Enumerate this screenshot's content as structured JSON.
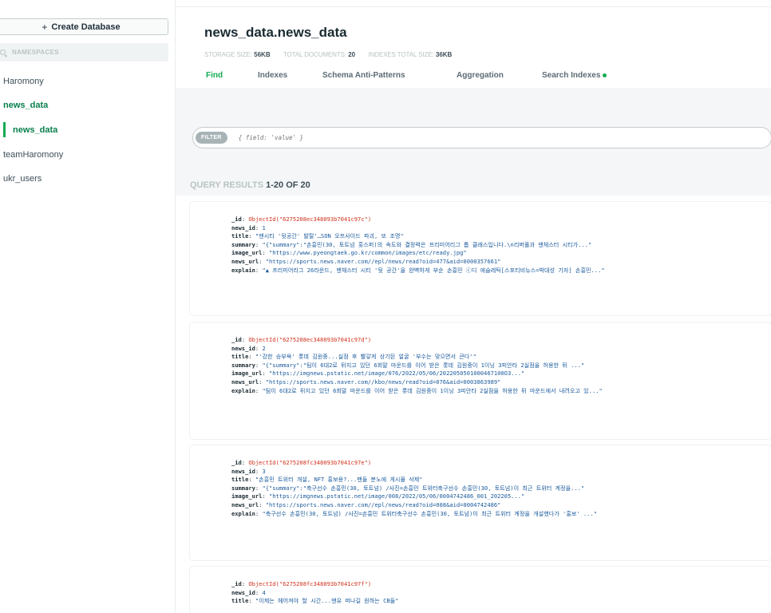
{
  "sidebar": {
    "create_button": "Create Database",
    "search_placeholder": "NAMESPACES",
    "items": [
      {
        "label": "Haromony"
      },
      {
        "label": "news_data"
      },
      {
        "label": "news_data"
      },
      {
        "label": "teamHaromony"
      },
      {
        "label": "ukr_users"
      }
    ]
  },
  "collection": {
    "title": "news_data.news_data",
    "stats": [
      {
        "label": "STORAGE SIZE:",
        "value": "56KB"
      },
      {
        "label": "TOTAL DOCUMENTS:",
        "value": "20"
      },
      {
        "label": "INDEXES TOTAL SIZE:",
        "value": "36KB"
      }
    ],
    "tabs": [
      {
        "label": "Find"
      },
      {
        "label": "Indexes"
      },
      {
        "label": "Schema Anti-Patterns"
      },
      {
        "label": "Aggregation"
      },
      {
        "label": "Search Indexes"
      }
    ]
  },
  "filter": {
    "label": "FILTER",
    "placeholder": "{ field: 'value' }"
  },
  "results": {
    "prefix": "QUERY RESULTS",
    "range": "1-20 OF 20"
  },
  "documents": [
    {
      "id": "ObjectId(\"6275208ec348093b7041c97c\")",
      "news_id": "1",
      "title": "\"맨시티 '뒷공간' 발탈'…SON 오프사이드 파괴, 또 조명\"",
      "summary": "\"{\"summary\":\"손흥민(30, 토트넘 홋스퍼)의 속도와 결정력은 프리미어리그 톱 클래스입니다.\\n리버풀과 맨체스터 시티가...\"",
      "image_url": "\"https://www.pyeongtaek.go.kr/common/images/etc/ready.jpg\"",
      "news_url": "\"https://sports.news.naver.com//epl/news/read?oid=477&aid=0000357661\"",
      "explain": "\"▲ 프리미어리그 26라운드, 맨체스터 시티 '뒷 공간'을 완벽하게 부순 손흥민 ⓒ디 애슬레틱[스포티비뉴스=박대성 기자] 손흥민...\""
    },
    {
      "id": "ObjectId(\"6275208ec348093b7041c97d\")",
      "news_id": "2",
      "title": "\"'강한 승부욕' 롯데 김원중...실점 후 빨갛게 상기된 얼굴 '부수는 맞으면서 큰다'\"",
      "summary": "\"{\"summary\":\"팀이 6대2로 뒤지고 있던 6회말 마운드를 이어 받은 롯데 김원중이 1이닝 3피안타 2실점을 허용한 뒤 ...\"",
      "image_url": "\"https://imgnews.pstatic.net/image/076/2022/05/06/2022050501000467100O3...\"",
      "news_url": "\"https://sports.news.naver.com//kbo/news/read?oid=076&aid=0003863989\"",
      "explain": "\"팀이 6대2로 뒤지고 있던 6회말 마운드를 이어 받은 롯데 김원중이 1이닝 3피안타 2실점을 허용한 뒤 마운드에서 내려오고 있...\""
    },
    {
      "id": "ObjectId(\"6275208fc348093b7041c97e\")",
      "news_id": "3",
      "title": "\"손흥민 트위터 개설, NFT 홍보용?...팬들 분노에 게시물 삭제\"",
      "summary": "\"{\"summary\":\"축구선수 손흥민(30, 토트넘) /사진=손흥민 트위터축구선수 손흥민(30, 토트넘)이 최근 트위터 계정을...\"",
      "image_url": "\"https://imgnews.pstatic.net/image/008/2022/05/06/0004742486_001_202205...\"",
      "news_url": "\"https://sports.news.naver.com//epl/news/read?oid=008&aid=0004742486\"",
      "explain": "\"축구선수 손흥민(30, 토트넘) /사진=손흥민 트위터축구선수 손흥민(30, 토트넘)이 최근 트위터 계정을 개설했다가 '홍보' ...\""
    },
    {
      "id": "ObjectId(\"6275208fc348093b7041c97f\")",
      "news_id": "4",
      "title": "\"이제는 헤어져야 할 시간...맨유 떠나길 원하는 CB들\""
    }
  ]
}
